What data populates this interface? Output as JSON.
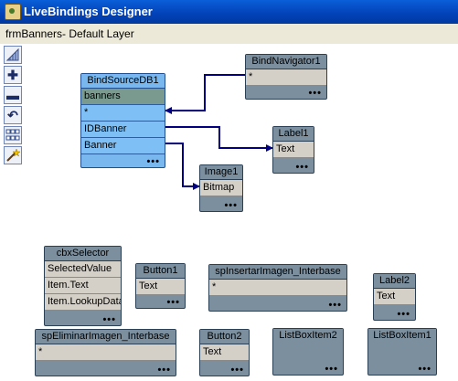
{
  "window": {
    "title": "LiveBindings Designer"
  },
  "header": {
    "form": "frmBanners",
    "layer": "- Default Layer"
  },
  "toolbar": {
    "buttons": [
      "grid-icon",
      "zoom-in-icon",
      "zoom-out-icon",
      "reset-icon",
      "layout-icon",
      "wand-icon"
    ]
  },
  "nodes": {
    "bindsource": {
      "title": "BindSourceDB1",
      "rows": [
        "banners",
        "*",
        "IDBanner",
        "Banner"
      ],
      "dots": "•••"
    },
    "bindnavigator": {
      "title": "BindNavigator1",
      "rows": [
        "*"
      ],
      "dots": "•••"
    },
    "label1": {
      "title": "Label1",
      "rows": [
        "Text"
      ],
      "dots": "•••"
    },
    "image1": {
      "title": "Image1",
      "rows": [
        "Bitmap"
      ],
      "dots": "•••"
    },
    "cbxselector": {
      "title": "cbxSelector",
      "rows": [
        "SelectedValue",
        "Item.Text",
        "Item.LookupData"
      ],
      "dots": "•••"
    },
    "button1": {
      "title": "Button1",
      "rows": [
        "Text"
      ],
      "dots": "•••"
    },
    "spinsertar": {
      "title": "spInsertarImagen_Interbase",
      "rows": [
        "*"
      ],
      "dots": "•••"
    },
    "label2": {
      "title": "Label2",
      "rows": [
        "Text"
      ],
      "dots": "•••"
    },
    "speliminar": {
      "title": "spEliminarImagen_Interbase",
      "rows": [
        "*"
      ],
      "dots": "•••"
    },
    "button2": {
      "title": "Button2",
      "rows": [
        "Text"
      ],
      "dots": "•••"
    },
    "listboxitem2": {
      "title": "ListBoxItem2",
      "dots": "•••"
    },
    "listboxitem1": {
      "title": "ListBoxItem1",
      "dots": "•••"
    }
  },
  "colors": {
    "link": "#000080",
    "selected_node": "#79b8ee",
    "node": "#7b8f9f"
  }
}
